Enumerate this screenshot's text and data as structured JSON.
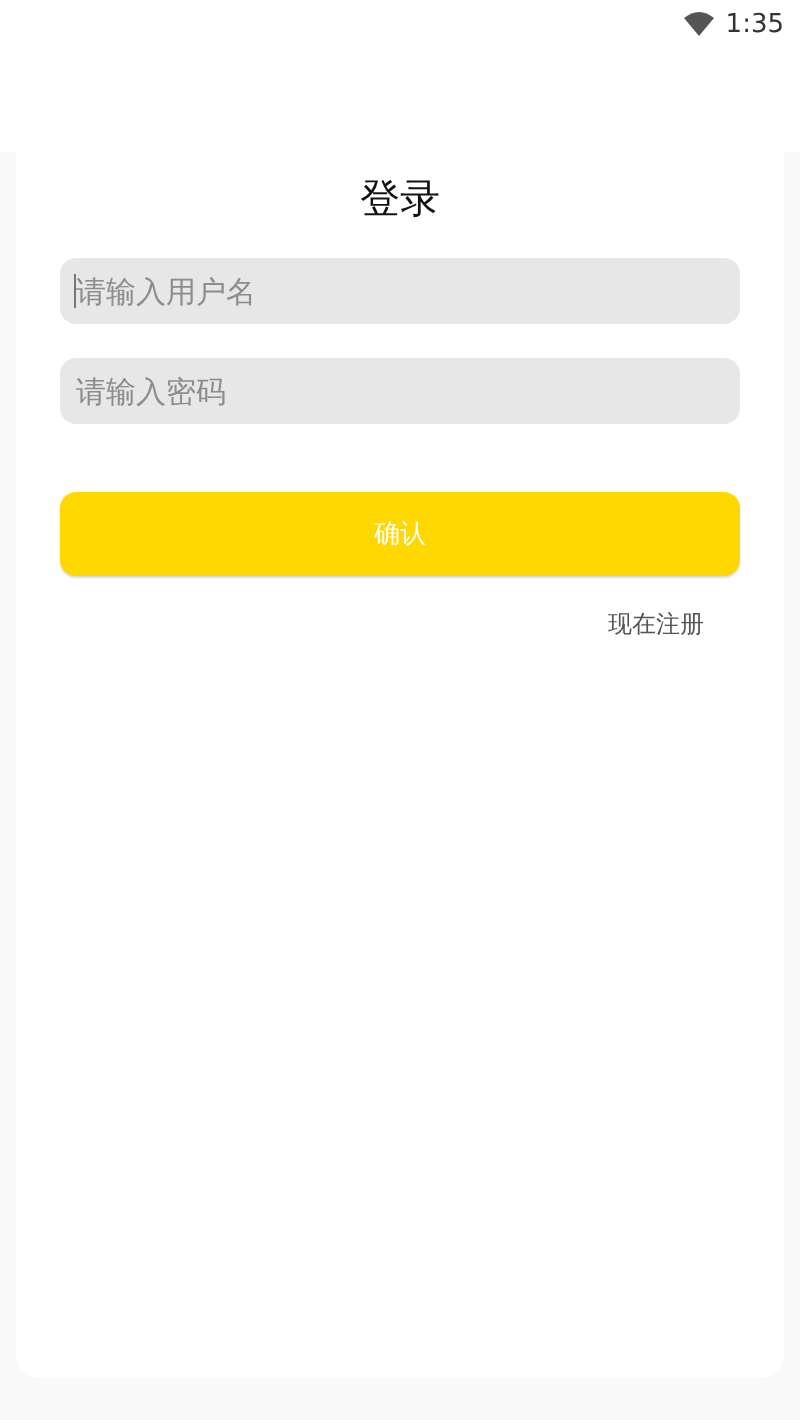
{
  "status_bar": {
    "time": "1:35"
  },
  "title": "登录",
  "fields": [
    {
      "placeholder": "请输入用户名",
      "focused": true
    },
    {
      "placeholder": "请输入密码",
      "focused": false
    }
  ],
  "confirm_button": "确认",
  "register_link": "现在注册"
}
